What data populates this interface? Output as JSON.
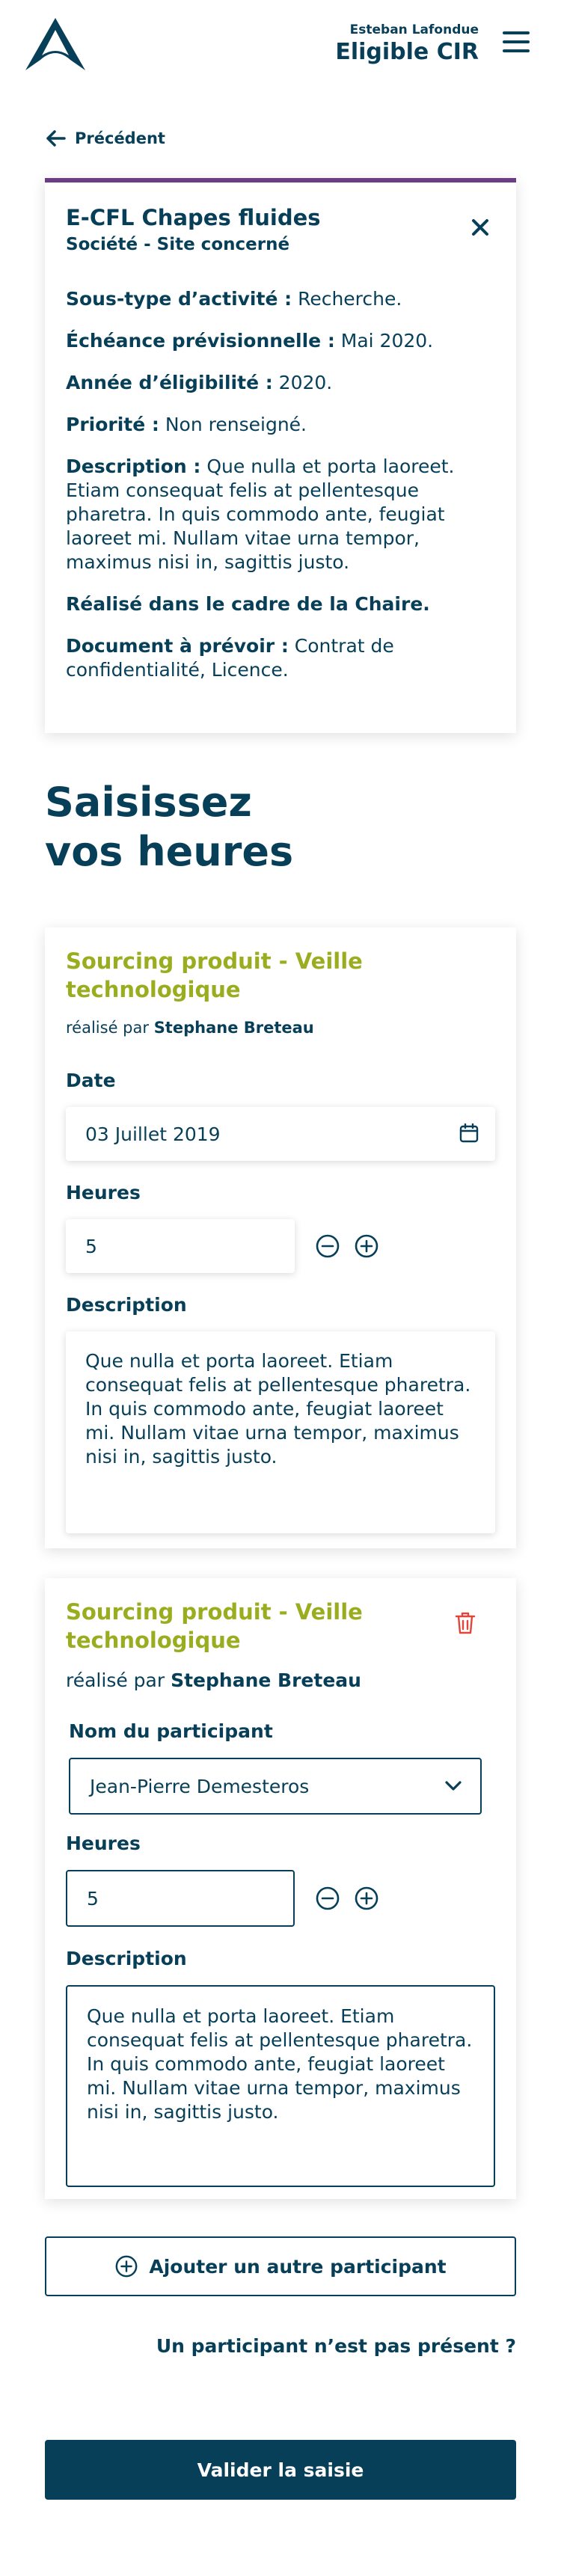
{
  "header": {
    "user_name": "Esteban Lafondue",
    "user_status": "Eligible CIR"
  },
  "nav": {
    "back_label": "Précédent"
  },
  "project": {
    "title": "E-CFL Chapes fluides",
    "subtitle": "Société - Site concerné",
    "fields": [
      {
        "label": "Sous-type d’activité :",
        "value": " Recherche."
      },
      {
        "label": "Échéance prévisionnelle :",
        "value": " Mai 2020."
      },
      {
        "label": "Année d’éligibilité :",
        "value": " 2020."
      },
      {
        "label": "Priorité :",
        "value": " Non renseigné."
      },
      {
        "label": "Description :",
        "value": " Que nulla et porta laoreet. Etiam consequat felis at pellentesque pharetra. In quis commodo ante, feugiat laoreet mi. Nullam vitae urna tempor, maximus nisi in, sagittis justo."
      }
    ],
    "chaire_note": "Réalisé dans le cadre de la Chaire.",
    "document_label": "Document à prévoir :",
    "document_value": " Contrat de confidentialité, Licence."
  },
  "section": {
    "title_line1": "Saisissez",
    "title_line2": "vos heures"
  },
  "entries": [
    {
      "title": "Sourcing produit - Veille technologique",
      "meta_prefix": "réalisé par ",
      "author": "Stephane Breteau",
      "date_label": "Date",
      "date_value": "03 Juillet 2019",
      "hours_label": "Heures",
      "hours_value": "5",
      "description_label": "Description",
      "description": "Que nulla et porta laoreet. Etiam consequat felis at pellentesque pharetra. In quis commodo ante, feugiat laoreet mi. Nullam vitae urna tempor, maximus nisi in, sagittis justo."
    },
    {
      "title": "Sourcing produit - Veille technologique",
      "meta_prefix": "réalisé par ",
      "author": "Stephane Breteau",
      "participant_label": "Nom du participant",
      "participant_value": "Jean-Pierre Demesteros",
      "hours_label": "Heures",
      "hours_value": "5",
      "description_label": "Description",
      "description": "Que nulla et porta laoreet. Etiam consequat felis at pellentesque pharetra. In quis commodo ante, feugiat laoreet mi. Nullam vitae urna tempor, maximus nisi in, sagittis justo."
    }
  ],
  "actions": {
    "add_participant": "Ajouter un autre participant",
    "missing_participant": "Un participant n’est pas présent ?",
    "submit": "Valider la saisie"
  },
  "colors": {
    "primary": "#083f58",
    "accent_green": "#9aad1e",
    "accent_purple": "#6b3d82",
    "danger": "#e0463c"
  }
}
